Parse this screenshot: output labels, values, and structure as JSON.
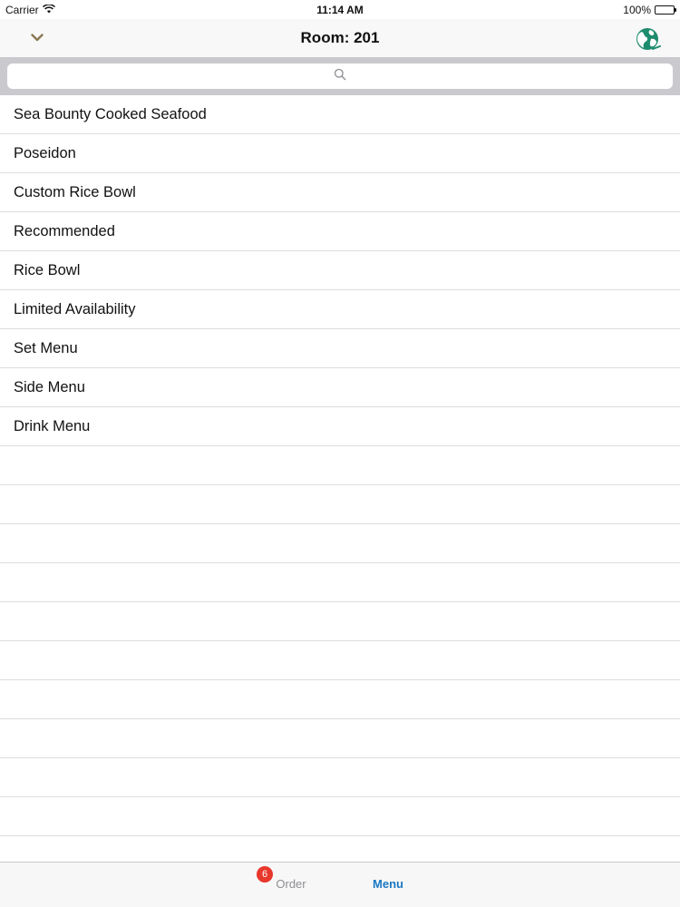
{
  "status_bar": {
    "carrier": "Carrier",
    "time": "11:14 AM",
    "battery": "100%",
    "wifi_icon": "wifi-icon",
    "battery_icon": "battery-icon"
  },
  "nav": {
    "title": "Room: 201",
    "left_icon": "chevron-down-icon",
    "right_icon": "globe-icon"
  },
  "search": {
    "placeholder": "",
    "value": "",
    "icon": "search-icon"
  },
  "menu_items": [
    "Sea Bounty Cooked Seafood",
    "Poseidon",
    "Custom Rice Bowl",
    "Recommended",
    "Rice Bowl",
    "Limited Availability",
    "Set Menu",
    "Side Menu",
    "Drink Menu"
  ],
  "tabs": {
    "order": {
      "label": "Order",
      "badge": "6"
    },
    "menu": {
      "label": "Menu"
    }
  },
  "colors": {
    "accent": "#1a78c2",
    "badge": "#e8372c",
    "chevron": "#8a7a52",
    "globe": "#1e8c6e"
  }
}
